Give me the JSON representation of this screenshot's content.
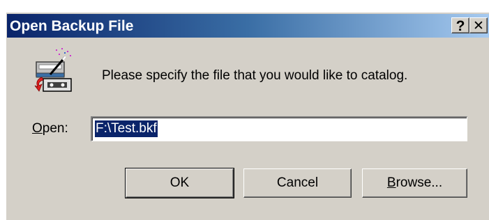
{
  "window": {
    "title": "Open Backup File",
    "help_label": "?",
    "close_label": "✕"
  },
  "dialog": {
    "prompt": "Please specify the file that you would like to catalog.",
    "open_label_accel": "O",
    "open_label_rest": "pen:",
    "open_value": "F:\\Test.bkf"
  },
  "buttons": {
    "ok": "OK",
    "cancel": "Cancel",
    "browse_accel": "B",
    "browse_rest": "rowse..."
  },
  "colors": {
    "titlebar_start": "#0a246a",
    "titlebar_end": "#a6caf0",
    "dialog_face": "#d4d0c8",
    "selection": "#0a246a"
  },
  "icons": [
    "backup-wizard-icon",
    "help-icon",
    "close-icon"
  ]
}
